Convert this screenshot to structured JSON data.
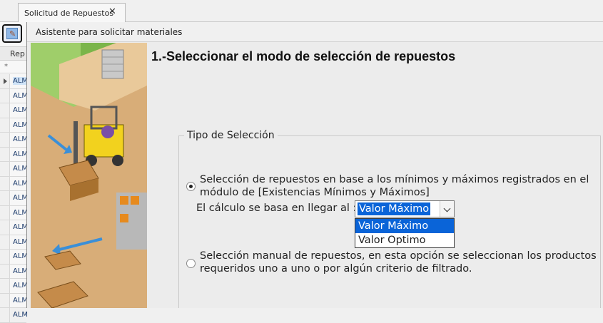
{
  "tabs": [
    {
      "label": "Solicitud de Repuestos",
      "close": "✕"
    }
  ],
  "grid": {
    "column_header": "Rep",
    "new_row_marker": "*",
    "rows": [
      "ALM",
      "ALM",
      "ALM",
      "ALM",
      "ALM",
      "ALM",
      "ALM",
      "ALM",
      "ALM",
      "ALM",
      "ALM",
      "ALM",
      "ALM",
      "ALM",
      "ALM",
      "ALM",
      "ALM"
    ]
  },
  "wizard": {
    "title": "Asistente para solicitar materiales",
    "step_title": "1.-Seleccionar el modo de selección de repuestos",
    "group_legend": "Tipo de Selección",
    "option_minmax": {
      "line1": "Selección de repuestos en base a los mínimos y máximos registrados en el",
      "line2": "módulo de [Existencias Mínimos y Máximos]",
      "checked": true
    },
    "calc_label": "El cálculo se basa en llegar al :",
    "combo_value": "Valor Máximo",
    "combo_options": [
      "Valor Máximo",
      "Valor Optimo"
    ],
    "option_manual": {
      "line1": "Selección manual de repuestos, en esta opción se seleccionan los productos",
      "line2": "requeridos uno a uno o por algún criterio de filtrado.",
      "checked": false
    }
  },
  "colors": {
    "selection": "#0a64d8",
    "window_bg": "#ececec"
  }
}
